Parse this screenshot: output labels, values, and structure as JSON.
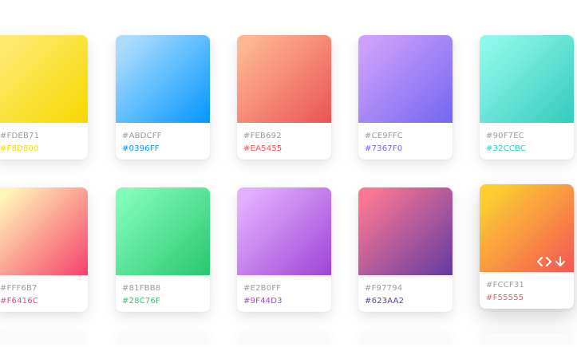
{
  "palettes": [
    {
      "from": "#FDEB71",
      "to": "#F8D800"
    },
    {
      "from": "#ABDCFF",
      "to": "#0396FF"
    },
    {
      "from": "#FEB692",
      "to": "#EA5455"
    },
    {
      "from": "#CE9FFC",
      "to": "#7367F0"
    },
    {
      "from": "#90F7EC",
      "to": "#32CCBC"
    },
    {
      "from": "#FFF6B7",
      "to": "#F6416C"
    },
    {
      "from": "#81FBB8",
      "to": "#28C76F"
    },
    {
      "from": "#E2B0FF",
      "to": "#9F44D3"
    },
    {
      "from": "#F97794",
      "to": "#623AA2"
    },
    {
      "from": "#FCCF31",
      "to": "#F55555"
    }
  ],
  "icons": {
    "code": "code-icon",
    "download": "download-icon"
  }
}
